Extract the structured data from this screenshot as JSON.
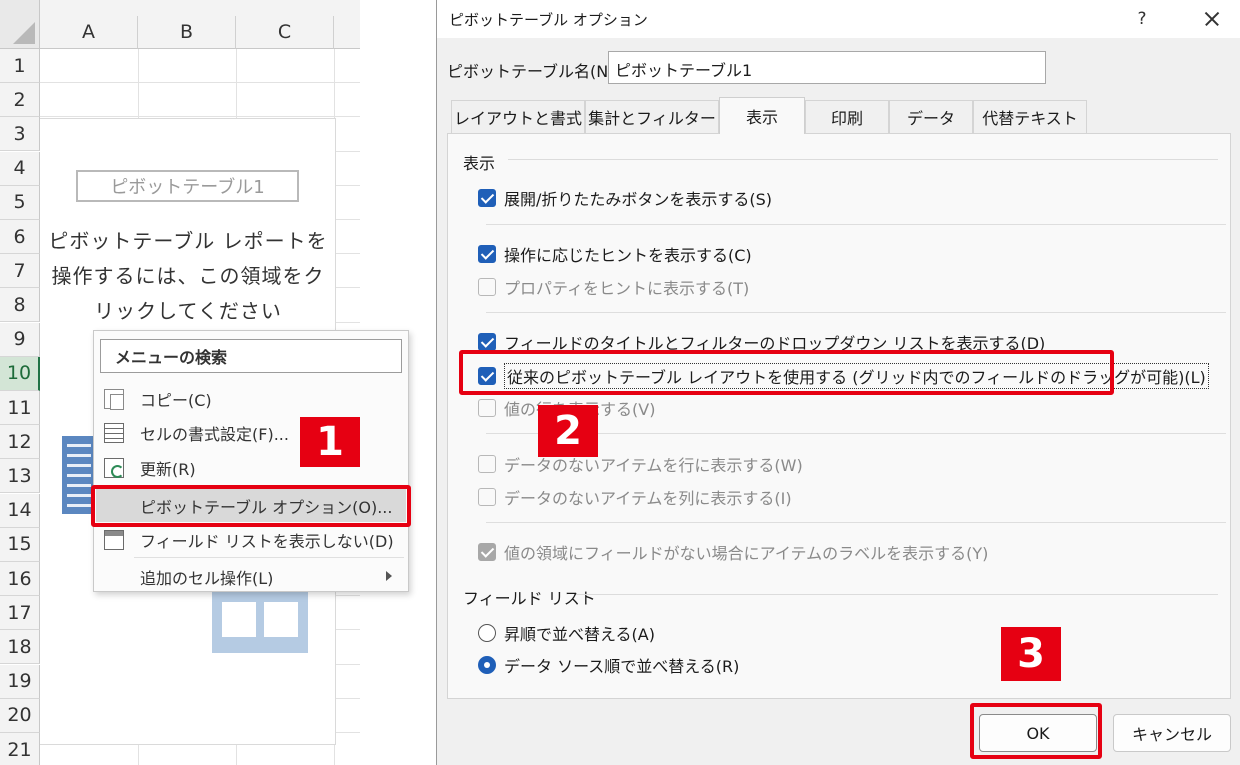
{
  "sheet": {
    "columns": [
      "A",
      "B",
      "C"
    ],
    "rows": [
      "1",
      "2",
      "3",
      "4",
      "5",
      "6",
      "7",
      "8",
      "9",
      "10",
      "11",
      "12",
      "13",
      "14",
      "15",
      "16",
      "17",
      "18",
      "19",
      "20",
      "21"
    ],
    "active_row": "10",
    "pivot_name": "ピボットテーブル1",
    "pivot_message": [
      "ピボットテーブル レポートを",
      "操作するには、この領域をク",
      "リックしてください"
    ]
  },
  "context_menu": {
    "search_label": "メニューの検索",
    "items": [
      {
        "label": "コピー(C)",
        "icon": "copy-icon"
      },
      {
        "label": "セルの書式設定(F)...",
        "icon": "format-cells-icon"
      },
      {
        "label": "更新(R)",
        "icon": "refresh-icon"
      },
      {
        "label": "ピボットテーブル オプション(O)...",
        "icon": ""
      },
      {
        "label": "フィールド リストを表示しない(D)",
        "icon": "field-list-icon"
      },
      {
        "label": "追加のセル操作(L)",
        "icon": ""
      }
    ]
  },
  "dialog": {
    "title": "ピボットテーブル オプション",
    "help": "?",
    "name_label": "ピボットテーブル名(N):",
    "name_value": "ピボットテーブル1",
    "tabs": [
      "レイアウトと書式",
      "集計とフィルター",
      "表示",
      "印刷",
      "データ",
      "代替テキスト"
    ],
    "active_tab": "表示",
    "display_group": "表示",
    "options": [
      {
        "label": "展開/折りたたみボタンを表示する(S)",
        "state": "on"
      },
      {
        "label": "操作に応じたヒントを表示する(C)",
        "state": "on"
      },
      {
        "label": "プロパティをヒントに表示する(T)",
        "state": "off-disabled"
      },
      {
        "label": "フィールドのタイトルとフィルターのドロップダウン リストを表示する(D)",
        "state": "on"
      },
      {
        "label": "従来のピボットテーブル レイアウトを使用する (グリッド内でのフィールドのドラッグが可能)(L)",
        "state": "on"
      },
      {
        "label": "値の行を表示する(V)",
        "state": "off-disabled"
      },
      {
        "label": "データのないアイテムを行に表示する(W)",
        "state": "off-disabled"
      },
      {
        "label": "データのないアイテムを列に表示する(I)",
        "state": "off-disabled"
      },
      {
        "label": "値の領域にフィールドがない場合にアイテムのラベルを表示する(Y)",
        "state": "on-disabled"
      }
    ],
    "field_list_group": "フィールド リスト",
    "radios": [
      {
        "label": "昇順で並べ替える(A)",
        "selected": false
      },
      {
        "label": "データ ソース順で並べ替える(R)",
        "selected": true
      }
    ],
    "ok_label": "OK",
    "cancel_label": "キャンセル"
  },
  "annotations": {
    "step1": "1",
    "step2": "2",
    "step3": "3",
    "highlight_color": "#e60012"
  }
}
